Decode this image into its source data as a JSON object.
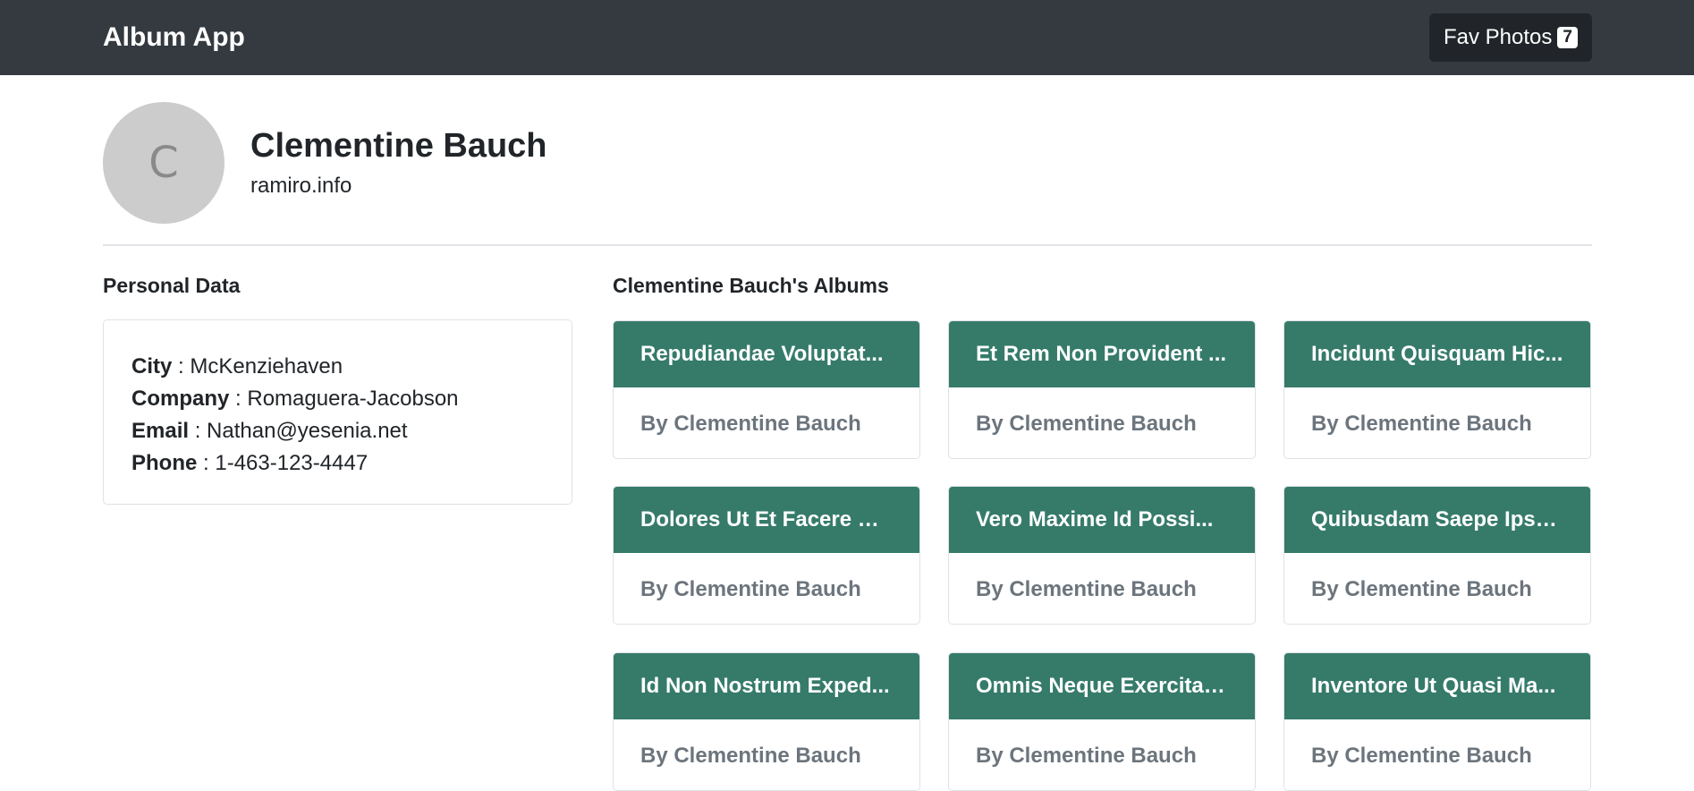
{
  "navbar": {
    "brand": "Album App",
    "fav_label": "Fav Photos",
    "fav_count": "7"
  },
  "profile": {
    "avatar_initial": "C",
    "name": "Clementine Bauch",
    "website": "ramiro.info"
  },
  "personal": {
    "title": "Personal Data",
    "rows": [
      {
        "label": "City",
        "sep": " : ",
        "value": "McKenziehaven"
      },
      {
        "label": "Company",
        "sep": " : ",
        "value": "Romaguera-Jacobson"
      },
      {
        "label": "Email",
        "sep": " : ",
        "value": "Nathan@yesenia.net"
      },
      {
        "label": "Phone",
        "sep": " : ",
        "value": "1-463-123-4447"
      }
    ]
  },
  "albums": {
    "title": "Clementine Bauch's Albums",
    "items": [
      {
        "title": "Repudiandae Voluptat...",
        "by": "By Clementine Bauch"
      },
      {
        "title": "Et Rem Non Provident ...",
        "by": "By Clementine Bauch"
      },
      {
        "title": "Incidunt Quisquam Hic...",
        "by": "By Clementine Bauch"
      },
      {
        "title": "Dolores Ut Et Facere Pl...",
        "by": "By Clementine Bauch"
      },
      {
        "title": "Vero Maxime Id Possi...",
        "by": "By Clementine Bauch"
      },
      {
        "title": "Quibusdam Saepe Ipsa...",
        "by": "By Clementine Bauch"
      },
      {
        "title": "Id Non Nostrum Exped...",
        "by": "By Clementine Bauch"
      },
      {
        "title": "Omnis Neque Exercitat...",
        "by": "By Clementine Bauch"
      },
      {
        "title": "Inventore Ut Quasi Ma...",
        "by": "By Clementine Bauch"
      }
    ]
  },
  "colors": {
    "navbar": "#343a40",
    "album_header": "#367b6a",
    "muted_text": "#6c757d"
  }
}
